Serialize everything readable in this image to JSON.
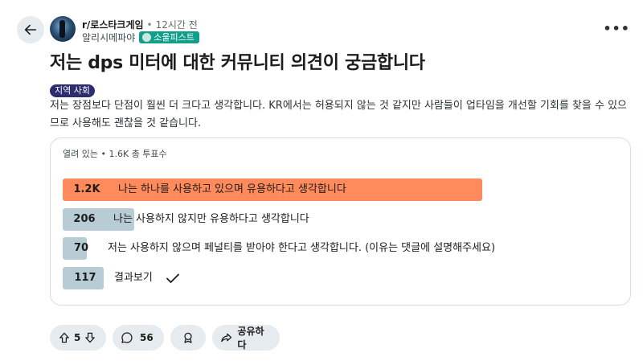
{
  "post": {
    "subreddit": "r/로스타크게임",
    "separator": "•",
    "time": "12시간 전",
    "author": "알리시메파야",
    "author_flair": "소울피스트",
    "title": "저는 dps 미터에 대한 커뮤니티 의견이 궁금합니다",
    "flair": "지역 사회",
    "body": "저는 장점보다 단점이 훨씬 더 크다고 생각합니다. KR에서는 허용되지 않는 것 같지만 사람들이 업타임을 개선할 기회를 찾을 수 있으므로 사용해도 괜찮을 것 같습니다.",
    "more_label": "•••"
  },
  "poll": {
    "status": "열려 있는",
    "separator": "•",
    "total_votes": "1.6K 총 투표수",
    "options": [
      {
        "count": "1.2K",
        "label": "나는 하나를 사용하고 있으며 유용하다고 생각합니다",
        "share": 1.0,
        "leading": true
      },
      {
        "count": "206",
        "label": "나는 사용하지 않지만 유용하다고 생각합니다",
        "share": 0.171,
        "leading": false
      },
      {
        "count": "70",
        "label": "저는 사용하지 않으며 페널티를 받아야 한다고 생각합니다. (이유는 댓글에 설명해주세요)",
        "share": 0.058,
        "leading": false
      },
      {
        "count": "117",
        "label": "결과보기",
        "share": 0.097,
        "leading": false,
        "selected": true
      }
    ],
    "colors": {
      "leading": "#ff8a5b",
      "other": "#b8ccd6"
    }
  },
  "actions": {
    "vote_count": "5",
    "comment_count": "56",
    "share_label": "공유하다"
  },
  "icons": {
    "back": "arrow-left-icon",
    "upvote": "arrow-up-icon",
    "downvote": "arrow-down-icon",
    "comment": "speech-bubble-icon",
    "award": "award-ribbon-icon",
    "share": "share-arrow-icon",
    "check": "checkmark-icon"
  }
}
